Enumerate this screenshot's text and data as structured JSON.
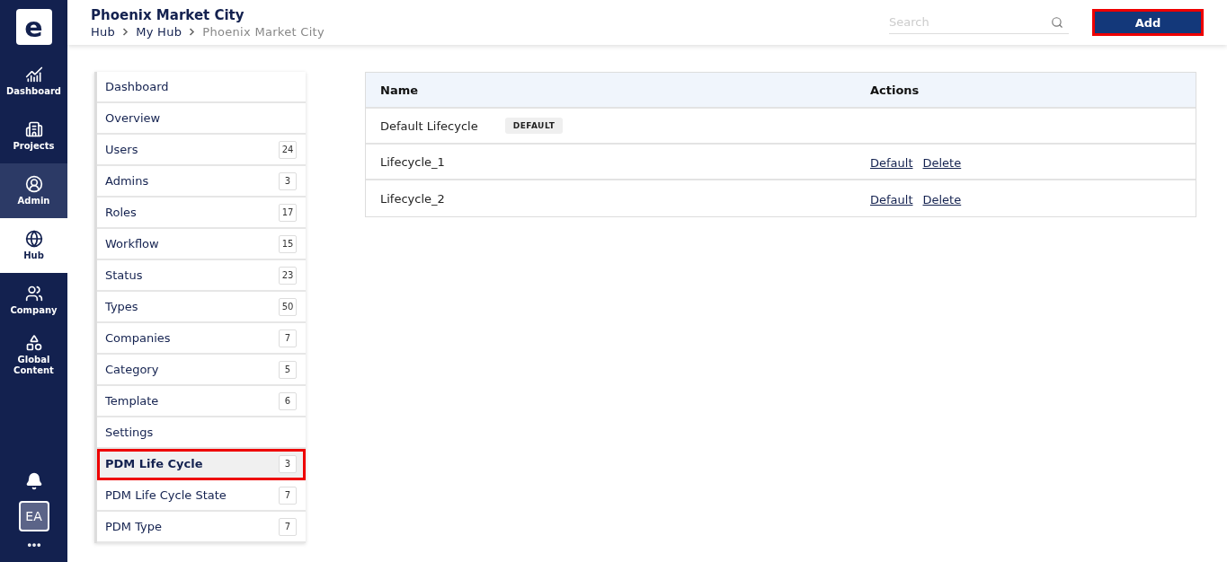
{
  "nav": {
    "logo": "e",
    "items": [
      {
        "label": "Dashboard",
        "selected": false,
        "hovered": false
      },
      {
        "label": "Projects",
        "selected": false,
        "hovered": false
      },
      {
        "label": "Admin",
        "selected": false,
        "hovered": true
      },
      {
        "label": "Hub",
        "selected": true,
        "hovered": false
      },
      {
        "label": "Company",
        "selected": false,
        "hovered": false
      },
      {
        "label": "Global Content",
        "selected": false,
        "hovered": false
      }
    ],
    "avatar": "EA"
  },
  "header": {
    "title": "Phoenix Market City",
    "breadcrumb": [
      "Hub",
      "My Hub",
      "Phoenix Market City"
    ],
    "search": {
      "placeholder": "Search"
    },
    "add_button": "Add"
  },
  "menu": [
    {
      "label": "Dashboard",
      "selected": false
    },
    {
      "label": "Overview",
      "selected": false
    },
    {
      "label": "Users",
      "count": "24",
      "selected": false
    },
    {
      "label": "Admins",
      "count": "3",
      "selected": false
    },
    {
      "label": "Roles",
      "count": "17",
      "selected": false
    },
    {
      "label": "Workflow",
      "count": "15",
      "selected": false
    },
    {
      "label": "Status",
      "count": "23",
      "selected": false
    },
    {
      "label": "Types",
      "count": "50",
      "selected": false
    },
    {
      "label": "Companies",
      "count": "7",
      "selected": false
    },
    {
      "label": "Category",
      "count": "5",
      "selected": false
    },
    {
      "label": "Template",
      "count": "6",
      "selected": false
    },
    {
      "label": "Settings",
      "selected": false
    },
    {
      "label": "PDM Life Cycle",
      "count": "3",
      "selected": true
    },
    {
      "label": "PDM Life Cycle State",
      "count": "7",
      "selected": false
    },
    {
      "label": "PDM Type",
      "count": "7",
      "selected": false
    }
  ],
  "table": {
    "columns": [
      "Name",
      "Actions"
    ],
    "rows": [
      {
        "name": "Default Lifecycle",
        "badge": "DEFAULT",
        "actions": []
      },
      {
        "name": "Lifecycle_1",
        "actions": [
          "Default",
          "Delete"
        ]
      },
      {
        "name": "Lifecycle_2",
        "actions": [
          "Default",
          "Delete"
        ]
      }
    ]
  }
}
